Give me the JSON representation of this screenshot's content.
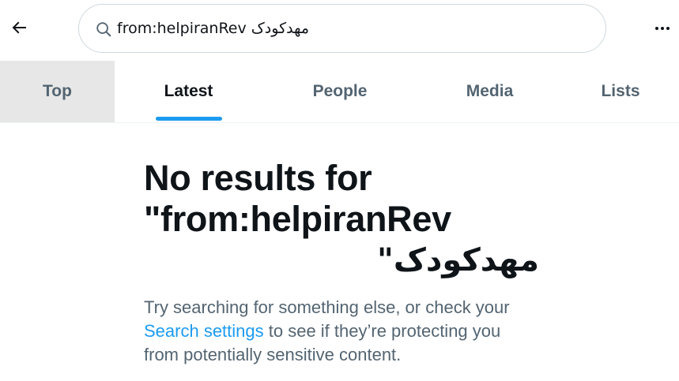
{
  "search": {
    "value": "from:helpiranRev مهدکودک"
  },
  "tabs": [
    {
      "label": "Top"
    },
    {
      "label": "Latest"
    },
    {
      "label": "People"
    },
    {
      "label": "Media"
    },
    {
      "label": "Lists"
    }
  ],
  "empty_state": {
    "title_line1": "No results for",
    "title_line2": "\"from:helpiranRev",
    "title_line3": "مهدکودک\"",
    "body_before": "Try searching for something else, or check your",
    "link": "Search settings",
    "body_after": " to see if they’re protecting you from potentially sensitive content."
  },
  "colors": {
    "accent": "#1d9bf0",
    "text_primary": "#0f1419",
    "text_secondary": "#536471",
    "tab_hover_bg": "#e7e7e7"
  },
  "icons": {
    "back": "arrow-left-icon",
    "search": "search-icon",
    "more": "more-horizontal-icon"
  }
}
